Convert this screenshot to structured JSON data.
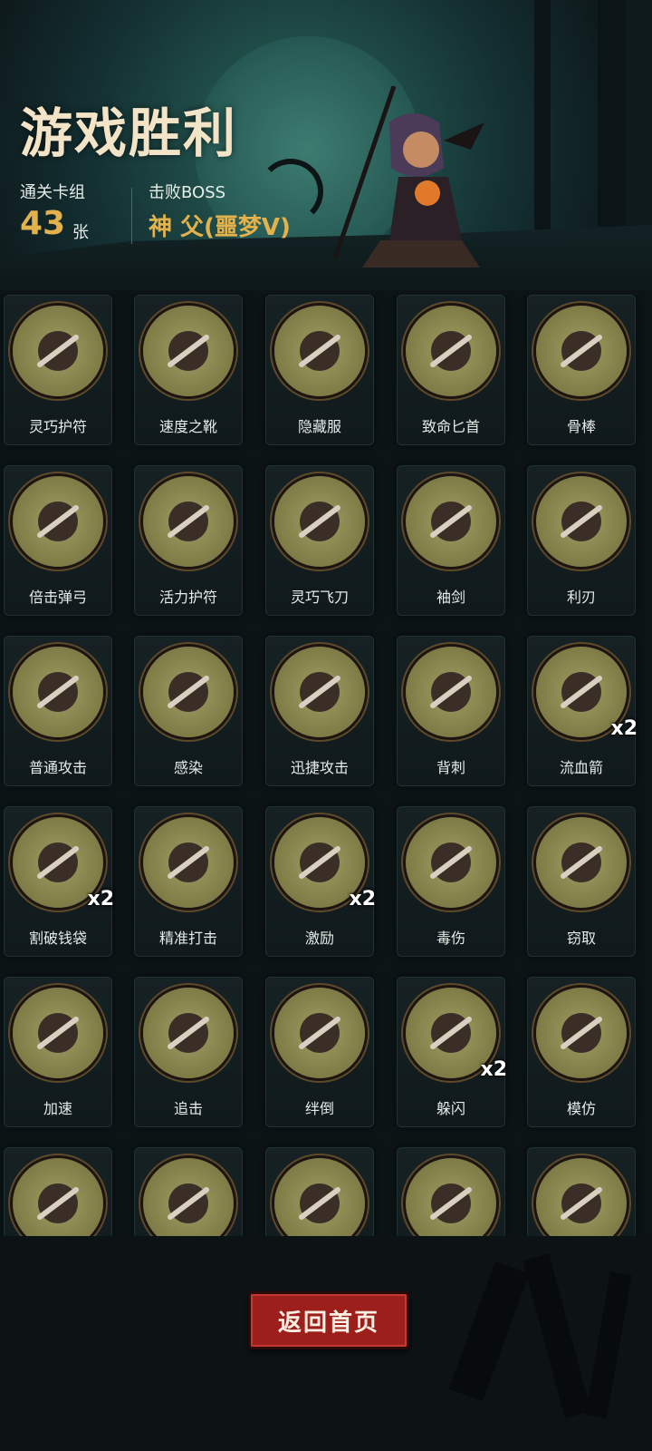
{
  "header": {
    "title": "游戏胜利",
    "deck_label": "通关卡组",
    "deck_count": "43",
    "deck_unit": "张",
    "boss_label": "击败BOSS",
    "boss_name": "神 父(噩梦V)"
  },
  "cards": [
    {
      "label": "灵巧护符",
      "icon": "amulet-icon",
      "badge": ""
    },
    {
      "label": "速度之靴",
      "icon": "boot-icon",
      "badge": ""
    },
    {
      "label": "隐藏服",
      "icon": "cloak-icon",
      "badge": ""
    },
    {
      "label": "致命匕首",
      "icon": "dagger-icon",
      "badge": ""
    },
    {
      "label": "骨棒",
      "icon": "bone-club-icon",
      "badge": ""
    },
    {
      "label": "倍击弹弓",
      "icon": "slingshot-icon",
      "badge": ""
    },
    {
      "label": "活力护符",
      "icon": "amulet-icon",
      "badge": ""
    },
    {
      "label": "灵巧飞刀",
      "icon": "throwing-knife-icon",
      "badge": ""
    },
    {
      "label": "袖剑",
      "icon": "sleeve-blade-icon",
      "badge": ""
    },
    {
      "label": "利刃",
      "icon": "blade-icon",
      "badge": ""
    },
    {
      "label": "普通攻击",
      "icon": "slash-icon",
      "badge": ""
    },
    {
      "label": "感染",
      "icon": "zombie-icon",
      "badge": ""
    },
    {
      "label": "迅捷攻击",
      "icon": "swift-strike-icon",
      "badge": ""
    },
    {
      "label": "背刺",
      "icon": "backstab-icon",
      "badge": ""
    },
    {
      "label": "流血箭",
      "icon": "bleed-arrow-icon",
      "badge": "x2"
    },
    {
      "label": "割破钱袋",
      "icon": "money-bag-icon",
      "badge": "x2"
    },
    {
      "label": "精准打击",
      "icon": "target-icon",
      "badge": ""
    },
    {
      "label": "激励",
      "icon": "hammer-icon",
      "badge": "x2"
    },
    {
      "label": "毒伤",
      "icon": "poison-icon",
      "badge": ""
    },
    {
      "label": "窃取",
      "icon": "goblin-icon",
      "badge": ""
    },
    {
      "label": "加速",
      "icon": "witch-icon",
      "badge": ""
    },
    {
      "label": "追击",
      "icon": "chase-icon",
      "badge": ""
    },
    {
      "label": "绊倒",
      "icon": "trip-icon",
      "badge": ""
    },
    {
      "label": "躲闪",
      "icon": "dodge-icon",
      "badge": "x2"
    },
    {
      "label": "模仿",
      "icon": "mimic-icon",
      "badge": ""
    },
    {
      "label": "",
      "icon": "skull-icon",
      "badge": ""
    },
    {
      "label": "",
      "icon": "creature-icon",
      "badge": ""
    },
    {
      "label": "",
      "icon": "heart-cross-icon",
      "badge": ""
    },
    {
      "label": "",
      "icon": "plague-doctor-icon",
      "badge": ""
    },
    {
      "label": "",
      "icon": "brute-icon",
      "badge": ""
    }
  ],
  "footer": {
    "back_button": "返回首页"
  },
  "colors": {
    "accent_gold": "#e4b24d",
    "button_red": "#9d1f1b",
    "card_circle": "#8c884f"
  }
}
